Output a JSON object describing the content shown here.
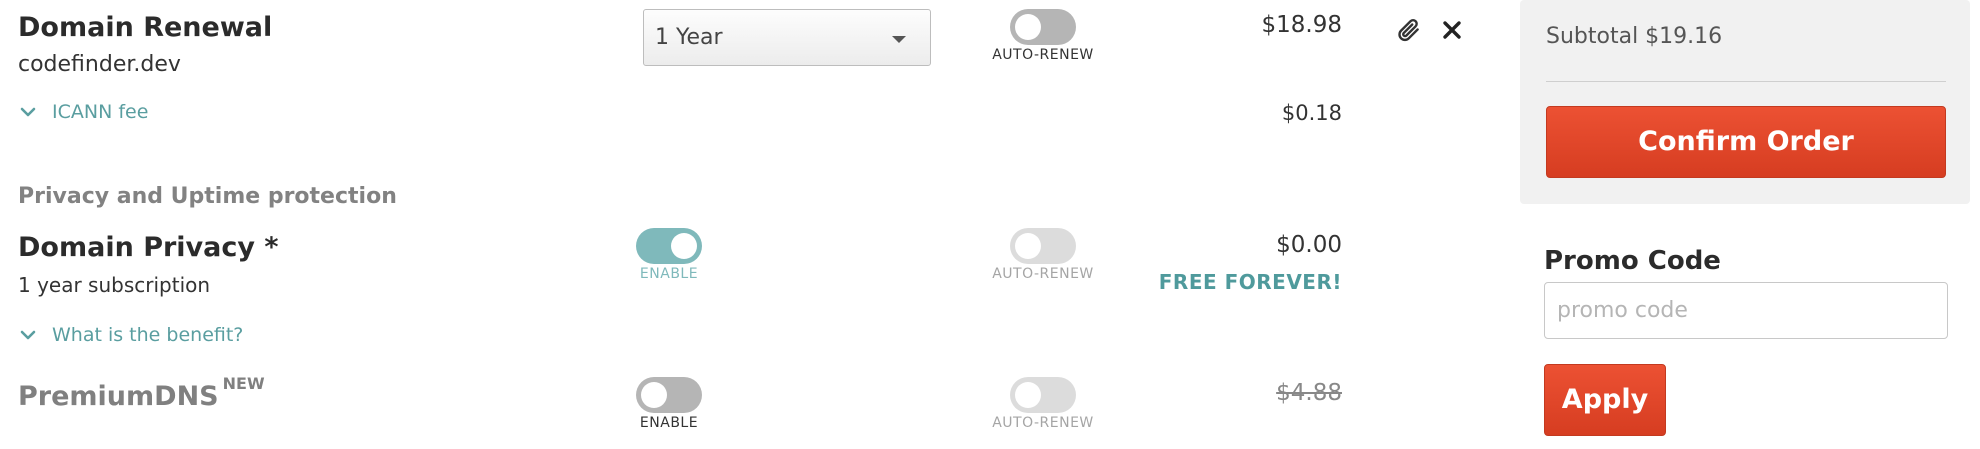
{
  "renewal": {
    "title": "Domain Renewal",
    "domain": "codefinder.dev",
    "term_selected": "1 Year",
    "auto_renew_label": "AUTO-RENEW",
    "auto_renew_enabled": false,
    "price": "$18.98",
    "icann_link": "ICANN fee",
    "icann_price": "$0.18"
  },
  "privacy_section": {
    "heading": "Privacy and Uptime protection"
  },
  "privacy": {
    "title": "Domain Privacy *",
    "subtitle": "1 year subscription",
    "enable_label": "ENABLE",
    "enabled": true,
    "auto_renew_label": "AUTO-RENEW",
    "price": "$0.00",
    "note": "FREE FOREVER!",
    "benefit_link": "What is the benefit?"
  },
  "premiumdns": {
    "title": "PremiumDNS",
    "badge": "NEW",
    "enable_label": "ENABLE",
    "enabled": false,
    "auto_renew_label": "AUTO-RENEW",
    "price": "$4.88"
  },
  "sidebar": {
    "subtotal": "Subtotal $19.16",
    "confirm_label": "Confirm Order",
    "promo_label": "Promo Code",
    "promo_placeholder": "promo code",
    "apply_label": "Apply"
  },
  "colors": {
    "accent_teal": "#5a9ea0",
    "button_red": "#e0462a",
    "toggle_on": "#7fb9bb"
  }
}
